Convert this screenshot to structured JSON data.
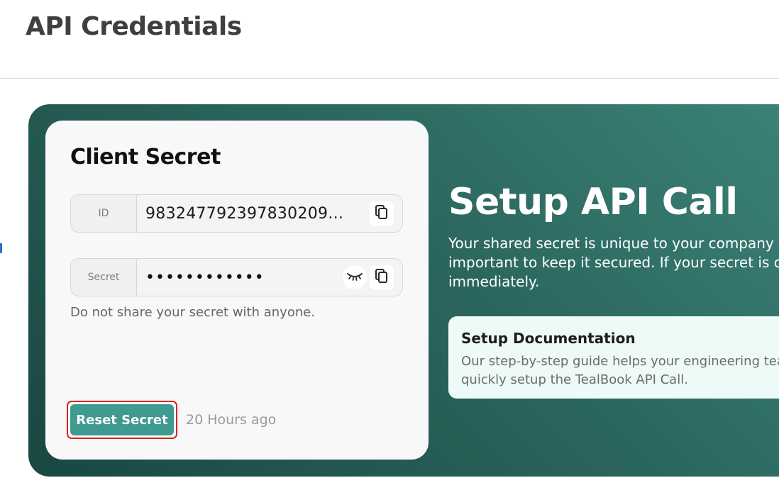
{
  "page": {
    "title": "API Credentials"
  },
  "client_secret": {
    "title": "Client Secret",
    "id_field": {
      "label": "ID",
      "value": "983247792397830209..."
    },
    "secret_field": {
      "label": "Secret",
      "value": "••••••••••••",
      "masked": true
    },
    "hint": "Do not share your secret with anyone.",
    "reset_button_label": "Reset Secret",
    "reset_time": "20 Hours ago"
  },
  "setup": {
    "title": "Setup API Call",
    "description_lines": [
      "Your shared secret is unique to your company",
      "important to keep it secured. If your secret is c",
      "immediately."
    ],
    "doc_card": {
      "title": "Setup Documentation",
      "description_lines": [
        "Our step-by-step guide helps your engineering tea",
        "quickly setup the TealBook API Call."
      ]
    }
  },
  "icons": {
    "copy": "copy-icon",
    "toggle_visibility": "eye-closed-icon"
  },
  "colors": {
    "banner_dark": "#194741",
    "banner_light": "#3c8379",
    "button_teal": "#3f9a8f",
    "highlight_red": "#d7261f",
    "doc_card_bg": "#edfaf7"
  }
}
